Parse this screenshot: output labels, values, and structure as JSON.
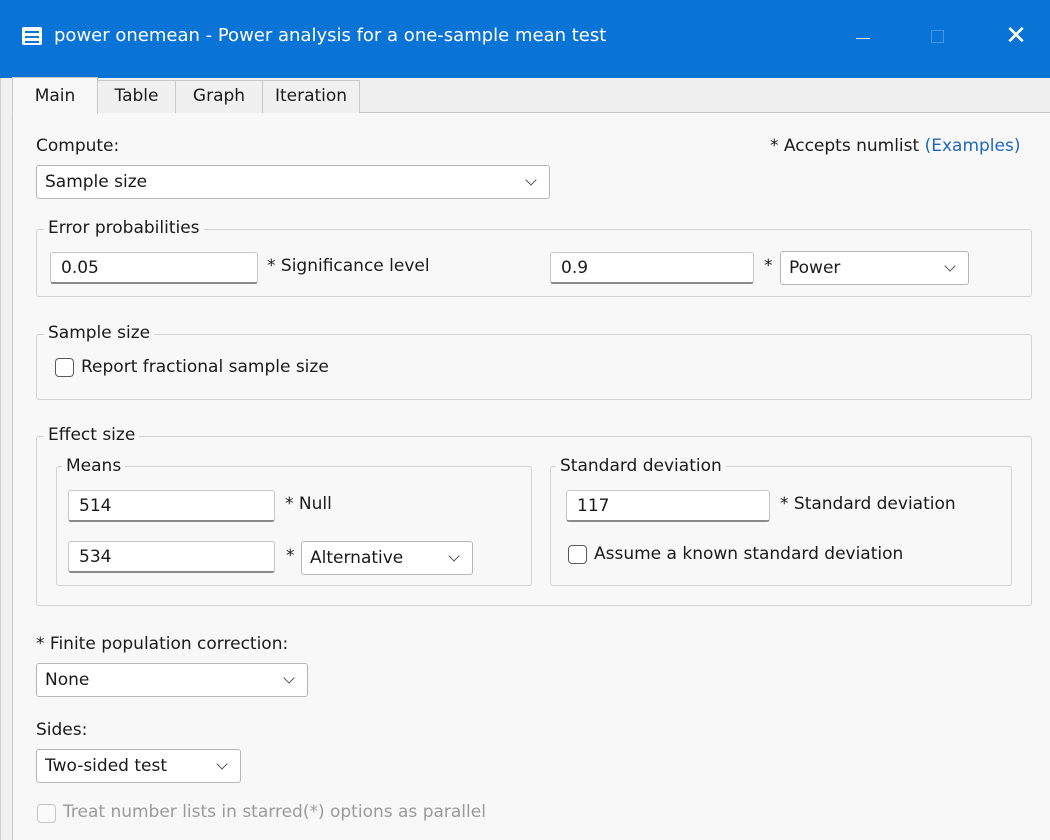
{
  "window": {
    "title": "power onemean - Power analysis for a one-sample mean test",
    "icon": "table-form-icon",
    "close_glyph": "✕"
  },
  "tabs": [
    {
      "label": "Main",
      "active": true
    },
    {
      "label": "Table",
      "active": false
    },
    {
      "label": "Graph",
      "active": false
    },
    {
      "label": "Iteration",
      "active": false
    }
  ],
  "compute": {
    "label": "Compute:",
    "value": "Sample size"
  },
  "numlist_note": {
    "prefix": "* Accepts numlist",
    "link": "(Examples)"
  },
  "error_prob": {
    "legend": "Error probabilities",
    "significance_value": "0.05",
    "significance_label": "* Significance level",
    "power_value": "0.9",
    "power_star": "*",
    "power_select": "Power"
  },
  "sample_size": {
    "legend": "Sample size",
    "fractional_label": "Report fractional sample size",
    "fractional_checked": false
  },
  "effect_size": {
    "legend": "Effect size",
    "means": {
      "legend": "Means",
      "null_value": "514",
      "null_label": "* Null",
      "alt_value": "534",
      "alt_star": "*",
      "alt_select": "Alternative"
    },
    "sd": {
      "legend": "Standard deviation",
      "value": "117",
      "label": "* Standard deviation",
      "known_label": "Assume a known standard deviation",
      "known_checked": false
    }
  },
  "fpc": {
    "label": "* Finite population correction:",
    "value": "None"
  },
  "sides": {
    "label": "Sides:",
    "value": "Two-sided test"
  },
  "parallel": {
    "label": "Treat number lists in starred(*) options as parallel",
    "enabled": false
  }
}
